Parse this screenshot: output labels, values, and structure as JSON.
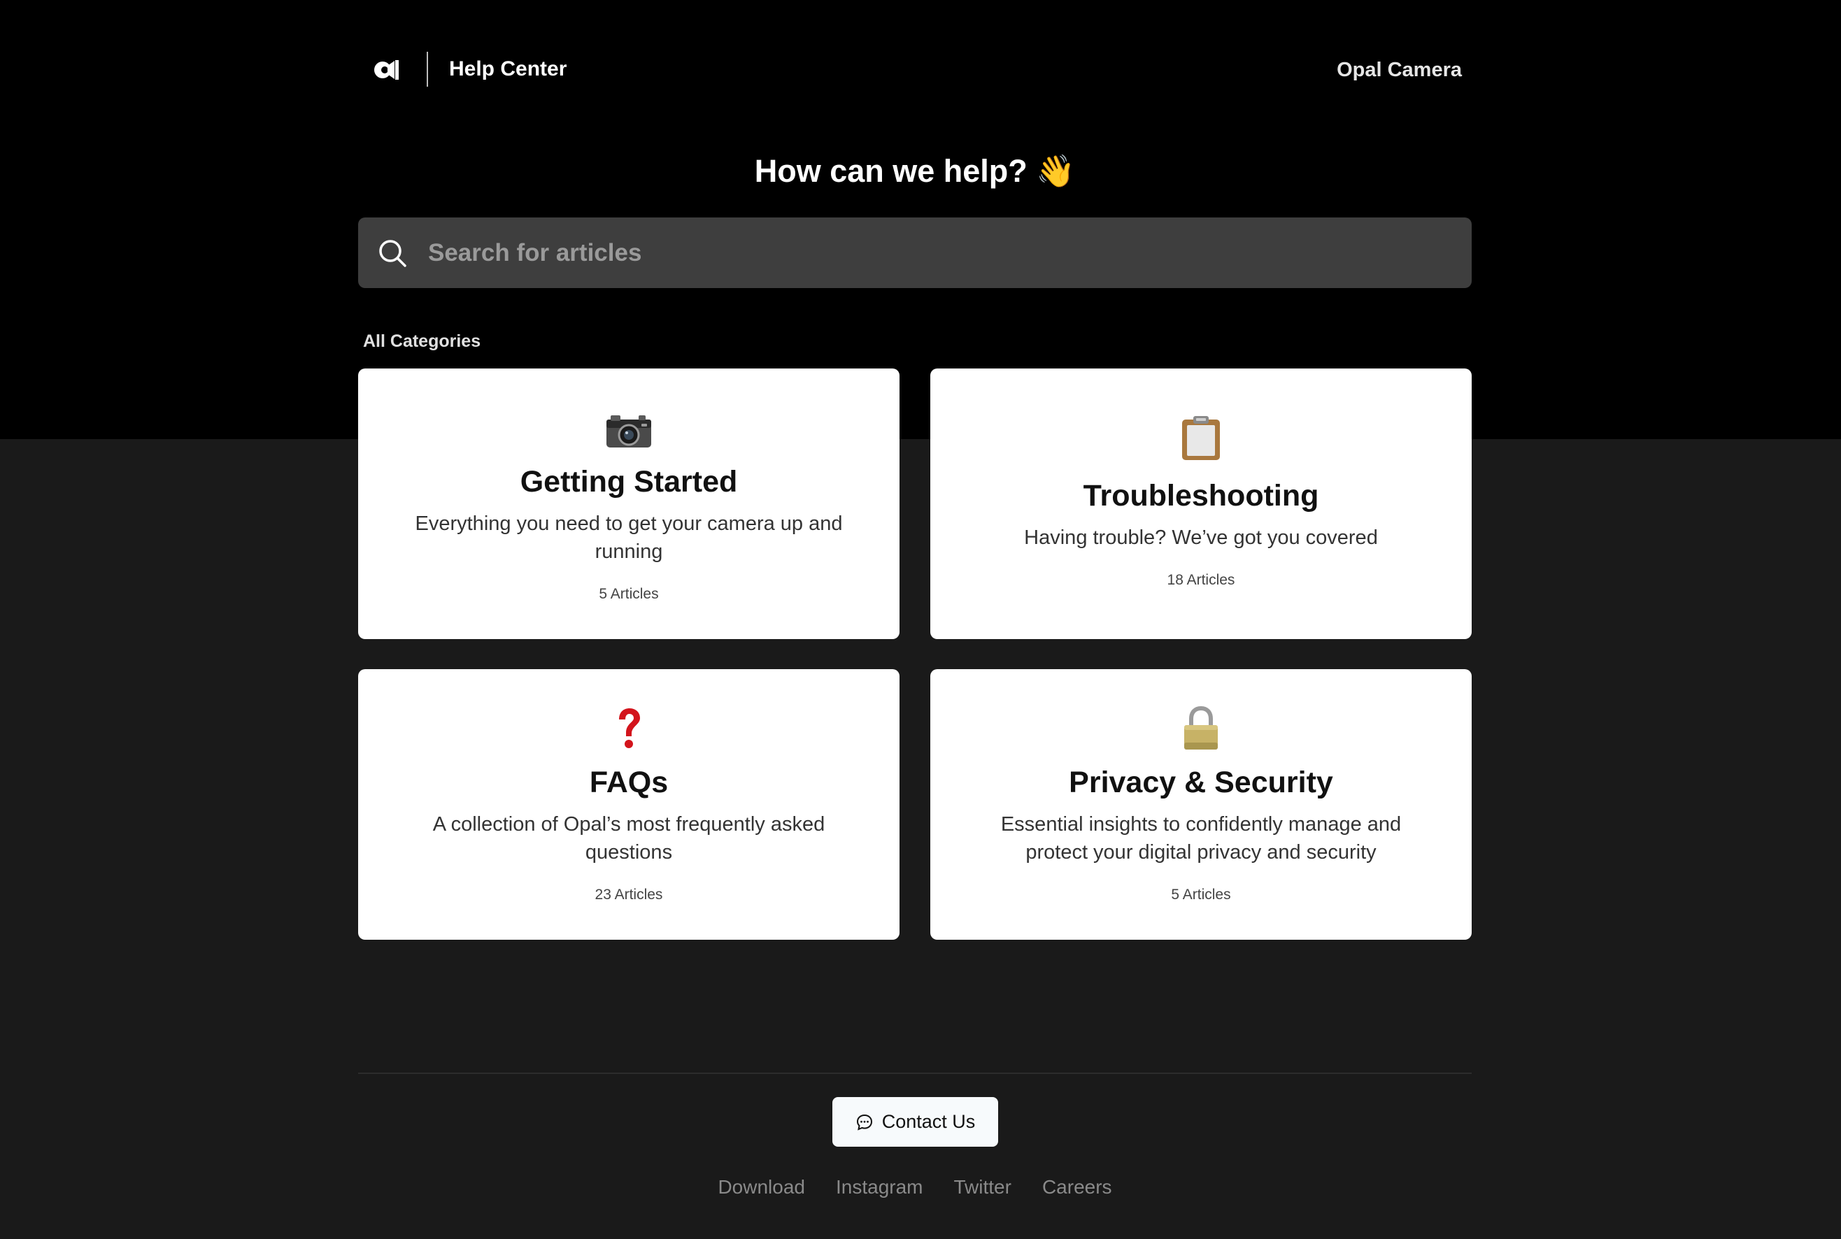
{
  "header": {
    "logo_icon": "opal-logo-icon",
    "title": "Help Center",
    "product": "Opal Camera"
  },
  "hero": {
    "title": "How can we help? 👋"
  },
  "search": {
    "placeholder": "Search for articles",
    "icon": "search-icon"
  },
  "categories": {
    "label": "All Categories",
    "items": [
      {
        "icon": "camera-icon",
        "title": "Getting Started",
        "description": "Everything you need to get your camera up and running",
        "count": "5 Articles"
      },
      {
        "icon": "clipboard-icon",
        "title": "Troubleshooting",
        "description": "Having trouble? We’ve got you covered",
        "count": "18 Articles"
      },
      {
        "icon": "question-mark-icon",
        "title": "FAQs",
        "description": "A collection of Opal’s most frequently asked questions",
        "count": "23 Articles"
      },
      {
        "icon": "lock-icon",
        "title": "Privacy & Security",
        "description": "Essential insights to confidently manage and protect your digital privacy and security",
        "count": "5 Articles"
      }
    ]
  },
  "footer": {
    "contact_label": "Contact Us",
    "contact_icon": "chat-bubble-icon",
    "links": [
      "Download",
      "Instagram",
      "Twitter",
      "Careers"
    ]
  },
  "colors": {
    "top_band": "#000000",
    "page_background": "#1a1a1a",
    "search_background": "#3e3e3e",
    "card_background": "#ffffff",
    "link_color": "#8a8a8a"
  }
}
